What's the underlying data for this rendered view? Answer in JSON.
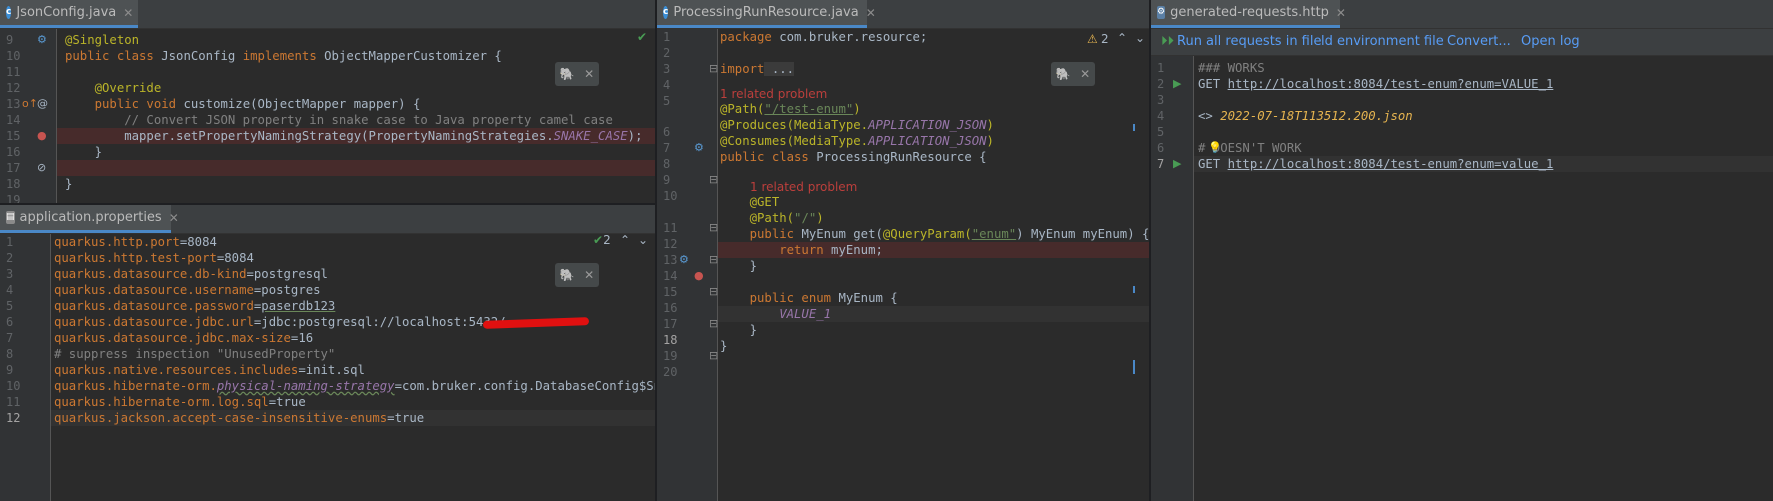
{
  "json_config": {
    "tab_title": "JsonConfig.java",
    "tab_icon": "c-class-icon",
    "line_numbers": [
      "9",
      "10",
      "11",
      "12",
      "13",
      "14",
      "15",
      "16",
      "17",
      "18",
      "19"
    ],
    "lines": [
      [
        "@Singleton"
      ],
      [
        "public class",
        " JsonConfig ",
        "implements",
        " ObjectMapperCustomizer {"
      ],
      [
        ""
      ],
      [
        "    @Override"
      ],
      [
        "    public void",
        " customize(ObjectMapper mapper) {"
      ],
      [
        "        // Convert JSON property in snake case to Java property camel case"
      ],
      [
        "        mapper.setPropertyNamingStrategy(PropertyNamingStrategies.",
        "SNAKE_CASE",
        ");"
      ],
      [
        "    }"
      ],
      [
        ""
      ],
      [
        "}"
      ],
      [
        ""
      ]
    ]
  },
  "app_props": {
    "tab_title": "application.properties",
    "warnings": "2",
    "line_numbers": [
      "1",
      "2",
      "3",
      "4",
      "5",
      "6",
      "7",
      "8",
      "9",
      "10",
      "11",
      "12"
    ],
    "lines": [
      [
        "quarkus.http.port",
        "=",
        "8084"
      ],
      [
        "quarkus.http.test-port",
        "=",
        "8084"
      ],
      [
        "quarkus.datasource.db-kind",
        "=",
        "postgresql"
      ],
      [
        "quarkus.datasource.username",
        "=",
        "postgres"
      ],
      [
        "quarkus.datasource.password",
        "=",
        "paserdb123"
      ],
      [
        "quarkus.datasource.jdbc.url",
        "=",
        "jdbc:postgresql://localhost:5432/"
      ],
      [
        "quarkus.datasource.jdbc.max-size",
        "=",
        "16"
      ],
      [
        "# suppress inspection \"UnusedProperty\""
      ],
      [
        "quarkus.native.resources.includes",
        "=",
        "init.sql"
      ],
      [
        "quarkus.hibernate-orm.",
        "physical-naming-strategy",
        "=",
        "com.bruker.config.DatabaseConfig$Snake"
      ],
      [
        "quarkus.hibernate-orm.log.sql",
        "=",
        "true"
      ],
      [
        "quarkus.jackson.accept-case-insensitive-enums",
        "=",
        "true"
      ]
    ]
  },
  "resource": {
    "tab_title": "ProcessingRunResource.java",
    "warnings": "2",
    "line_numbers": [
      "1",
      "2",
      "3",
      "4",
      "5",
      "",
      "6",
      "7",
      "8",
      "9",
      "10",
      "",
      "11",
      "12",
      "13",
      "14",
      "15",
      "16",
      "17",
      "18",
      "19",
      "20"
    ],
    "related_problem": "1 related problem",
    "lines": {
      "l1": [
        "package",
        " com.bruker.resource;"
      ],
      "l3": [
        "import",
        " ..."
      ],
      "l6": [
        "@Path(",
        "\"/test-enum\"",
        ")"
      ],
      "l7": [
        "@Produces(MediaType.",
        "APPLICATION_JSON",
        ")"
      ],
      "l8": [
        "@Consumes(MediaType.",
        "APPLICATION_JSON",
        ")"
      ],
      "l9": [
        "public class",
        " ProcessingRunResource {"
      ],
      "l11": [
        "    @GET"
      ],
      "l12": [
        "    @Path(",
        "\"/\"",
        ")"
      ],
      "l13": [
        "    public",
        " MyEnum get(",
        "@QueryParam(",
        "\"enum\"",
        ") MyEnum myEnum) {"
      ],
      "l14": [
        "        return",
        " myEnum;"
      ],
      "l15": [
        "    }"
      ],
      "l17": [
        "    public enum",
        " MyEnum {"
      ],
      "l18": [
        "        VALUE_1"
      ],
      "l19": [
        "    }"
      ],
      "l20": [
        "}"
      ]
    }
  },
  "http": {
    "tab_title": "generated-requests.http",
    "toolbar": {
      "run_all": "Run all requests in file",
      "add_env": "ld environment file",
      "convert": "Convert...",
      "open_log": "Open log"
    },
    "line_numbers": [
      "1",
      "2",
      "3",
      "4",
      "5",
      "6",
      "7"
    ],
    "lines": [
      "### WORKS",
      "GET",
      "http://localhost:8084/test-enum?enum=VALUE_1",
      "",
      "<> ",
      "2022-07-18T113512.200.json",
      "",
      "# DOESN'T WORK",
      "GET",
      "http://localhost:8084/test-enum?enum=value_1"
    ]
  },
  "colors": {
    "background": "#2b2b2b",
    "gutter": "#313335",
    "keyword": "#cc7832",
    "annotation": "#bbb529",
    "string": "#6a8759",
    "comment": "#808080",
    "field": "#9876aa",
    "error_line": "#472b2b",
    "accent": "#4a88c7"
  }
}
